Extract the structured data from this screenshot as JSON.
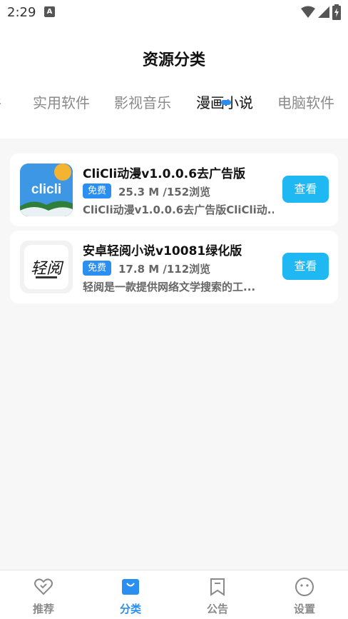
{
  "status_bar": {
    "time": "2:29",
    "notification_badge": "A"
  },
  "header": {
    "title": "资源分类"
  },
  "tabs": [
    {
      "label": "件"
    },
    {
      "label": "实用软件"
    },
    {
      "label": "影视音乐"
    },
    {
      "label": "漫画小说",
      "active": true
    },
    {
      "label": "电脑软件"
    }
  ],
  "items": [
    {
      "icon": "clicli-app-icon",
      "icon_text": "clicli",
      "title": "CliCli动漫v1.0.0.6去广告版",
      "badge": "免费",
      "meta": "25.3 M /152浏览",
      "description": "CliCli动漫v1.0.0.6去广告版CliCli动...",
      "button": "查看"
    },
    {
      "icon": "qingyue-app-icon",
      "icon_text": "轻阅",
      "title": "安卓轻阅小说v10081绿化版",
      "badge": "免费",
      "meta": "17.8 M /112浏览",
      "description": "轻阅是一款提供网络文学搜索的工...",
      "button": "查看"
    }
  ],
  "bottom_nav": [
    {
      "label": "推荐",
      "icon": "heart-icon"
    },
    {
      "label": "分类",
      "icon": "bag-icon",
      "active": true
    },
    {
      "label": "公告",
      "icon": "bookmark-icon"
    },
    {
      "label": "设置",
      "icon": "smiley-icon"
    }
  ],
  "colors": {
    "accent": "#2a8ff0",
    "button": "#1fb8f3",
    "background": "#f7f7f7"
  }
}
